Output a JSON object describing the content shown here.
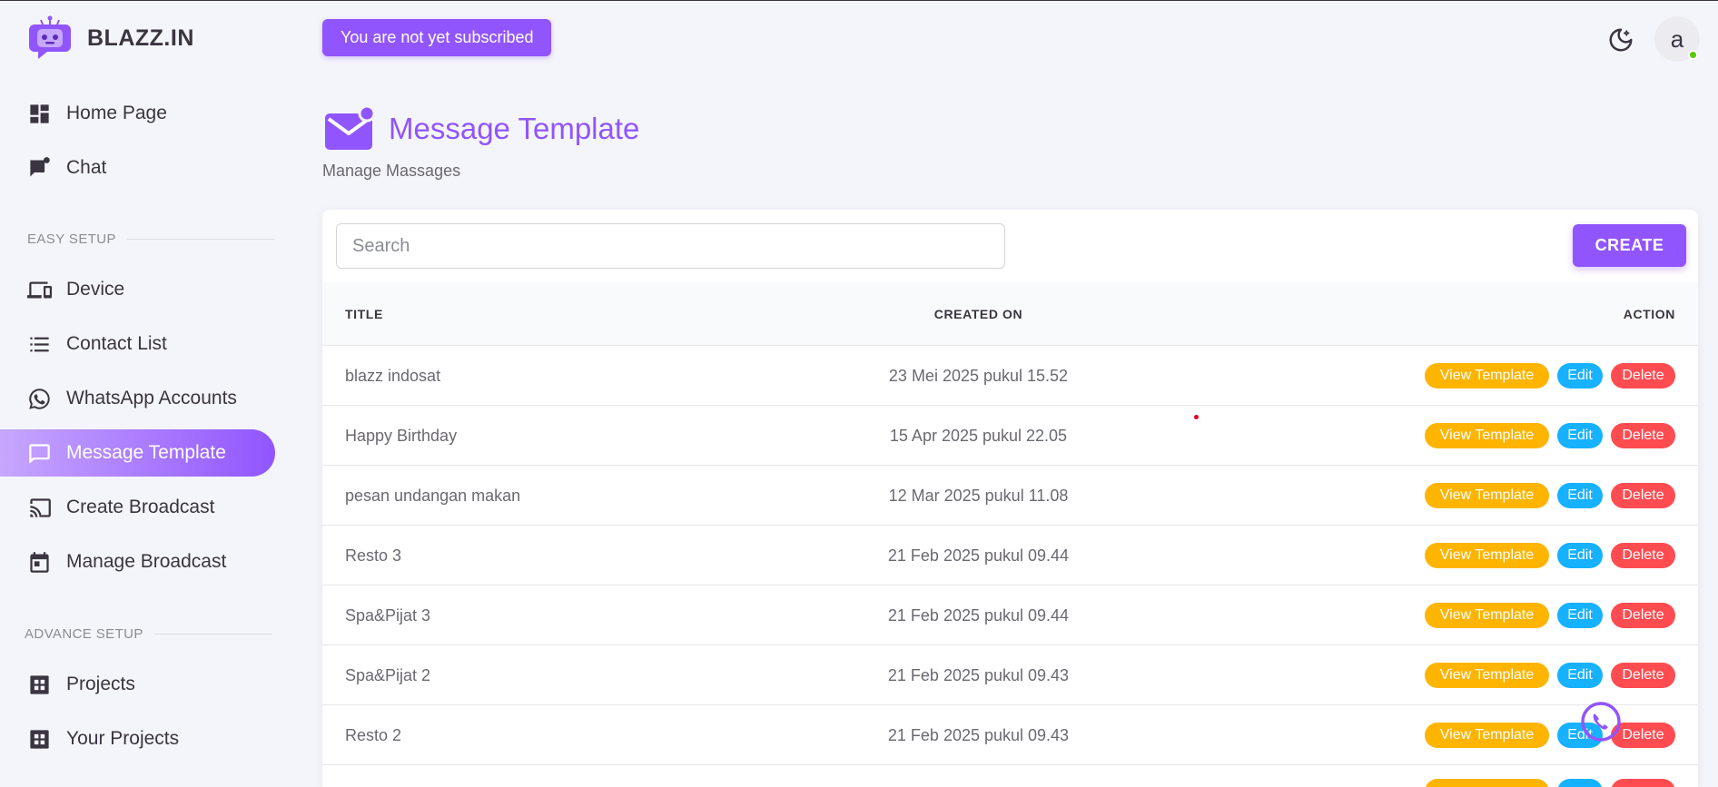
{
  "brand": {
    "name": "BLAZZ.IN"
  },
  "header": {
    "subscription_badge": "You are not yet subscribed",
    "avatar_initial": "a"
  },
  "sidebar": {
    "top_items": [
      {
        "label": "Home Page",
        "icon": "dashboard-icon"
      },
      {
        "label": "Chat",
        "icon": "chat-icon"
      }
    ],
    "easy_setup_label": "EASY SETUP",
    "easy_setup_items": [
      {
        "label": "Device",
        "icon": "devices-icon"
      },
      {
        "label": "Contact List",
        "icon": "list-icon"
      },
      {
        "label": "WhatsApp Accounts",
        "icon": "whatsapp-icon"
      },
      {
        "label": "Message Template",
        "icon": "message-icon",
        "active": true
      },
      {
        "label": "Create Broadcast",
        "icon": "cast-icon"
      },
      {
        "label": "Manage Broadcast",
        "icon": "calendar-icon"
      }
    ],
    "advance_setup_label": "ADVANCE SETUP",
    "advance_setup_items": [
      {
        "label": "Projects",
        "icon": "apps-icon"
      },
      {
        "label": "Your Projects",
        "icon": "apps-icon"
      }
    ]
  },
  "page": {
    "title": "Message Template",
    "subtitle": "Manage Massages"
  },
  "toolbar": {
    "search_placeholder": "Search",
    "create_label": "CREATE"
  },
  "table": {
    "columns": {
      "title": "TITLE",
      "created_on": "CREATED ON",
      "action": "ACTION"
    },
    "action_labels": {
      "view": "View Template",
      "edit": "Edit",
      "delete": "Delete"
    },
    "rows": [
      {
        "title": "blazz indosat",
        "created_on": "23 Mei 2025 pukul 15.52"
      },
      {
        "title": "Happy Birthday",
        "created_on": "15 Apr 2025 pukul 22.05"
      },
      {
        "title": "pesan undangan makan",
        "created_on": "12 Mar 2025 pukul 11.08"
      },
      {
        "title": "Resto 3",
        "created_on": "21 Feb 2025 pukul 09.44"
      },
      {
        "title": "Spa&Pijat 3",
        "created_on": "21 Feb 2025 pukul 09.44"
      },
      {
        "title": "Spa&Pijat 2",
        "created_on": "21 Feb 2025 pukul 09.43"
      },
      {
        "title": "Resto 2",
        "created_on": "21 Feb 2025 pukul 09.43"
      },
      {
        "title": "",
        "created_on": ""
      }
    ]
  },
  "colors": {
    "primary": "#9155fd",
    "warning": "#ffb400",
    "info": "#16b1ff",
    "error": "#ff4c51",
    "online": "#56ca00"
  }
}
